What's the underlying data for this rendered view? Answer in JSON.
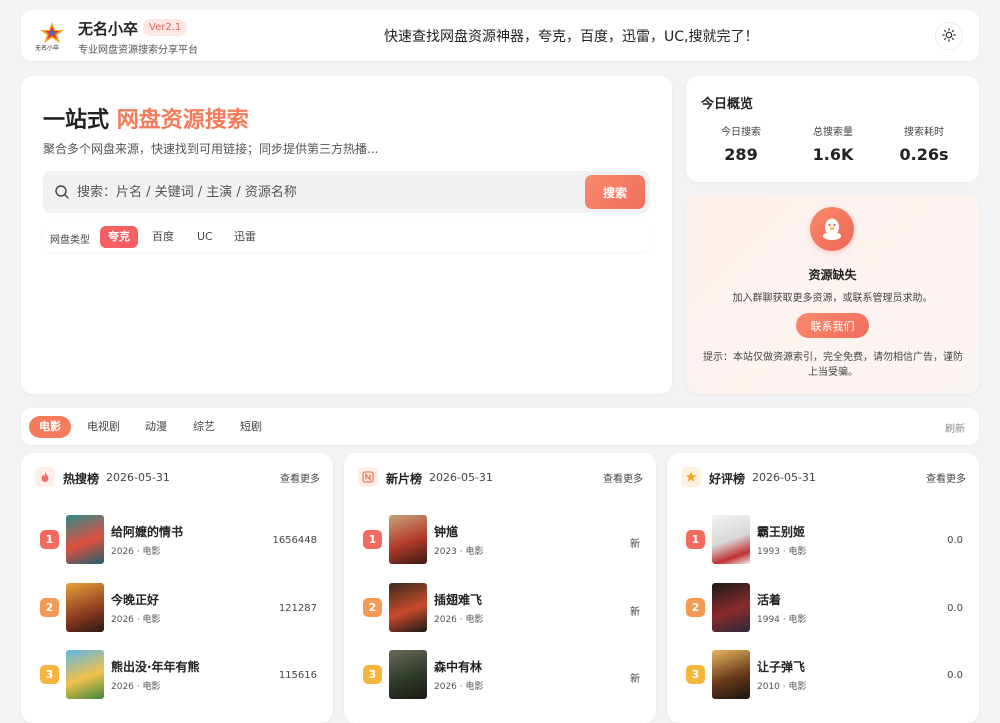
{
  "header": {
    "logo_text": "无名小卒",
    "brand_name": "无名小卒",
    "version": "Ver2.1",
    "subtitle": "专业网盘资源搜索分享平台",
    "slogan": "快速查找网盘资源神器，夸克，百度，迅雷，UC,搜就完了！",
    "theme_icon": "sun-icon"
  },
  "search": {
    "title_prefix": "一站式",
    "title_accent": "网盘资源搜索",
    "description": "聚合多个网盘来源，快速找到可用链接；同步提供第三方热播...",
    "placeholder": "搜索：片名 / 关键词 / 主演 / 资源名称",
    "button_label": "搜索",
    "type_label": "网盘类型",
    "types": [
      "夸克",
      "百度",
      "UC",
      "迅雷"
    ],
    "active_type": "夸克"
  },
  "overview": {
    "title": "今日概览",
    "stats": [
      {
        "label": "今日搜索",
        "value": "289"
      },
      {
        "label": "总搜索量",
        "value": "1.6K"
      },
      {
        "label": "搜索耗时",
        "value": "0.26s"
      }
    ]
  },
  "missing": {
    "icon": "qq-penguin-icon",
    "title": "资源缺失",
    "description": "加入群聊获取更多资源，或联系管理员求助。",
    "button_label": "联系我们",
    "tip": "提示：本站仅做资源索引，完全免费，请勿相信广告，谨防上当受骗。"
  },
  "categories": {
    "tabs": [
      "电影",
      "电视剧",
      "动漫",
      "综艺",
      "短剧"
    ],
    "active": "电影",
    "refresh_label": "刷新"
  },
  "rankings": [
    {
      "title": "热搜榜",
      "date": "2026-05-31",
      "more_label": "查看更多",
      "icon": "fire-icon",
      "icon_color": "#f06d5f",
      "items": [
        {
          "rank": "1",
          "name": "给阿嬷的情书",
          "year": "2026",
          "genre": "电影",
          "score": "1656448"
        },
        {
          "rank": "2",
          "name": "今晚正好",
          "year": "2026",
          "genre": "电影",
          "score": "121287"
        },
        {
          "rank": "3",
          "name": "熊出没·年年有熊",
          "year": "2026",
          "genre": "电影",
          "score": "115616"
        }
      ]
    },
    {
      "title": "新片榜",
      "date": "2026-05-31",
      "more_label": "查看更多",
      "icon": "new-badge-icon",
      "icon_color": "#f47b5b",
      "items": [
        {
          "rank": "1",
          "name": "钟馗",
          "year": "2023",
          "genre": "电影",
          "score": "新"
        },
        {
          "rank": "2",
          "name": "插翅难飞",
          "year": "2026",
          "genre": "电影",
          "score": "新"
        },
        {
          "rank": "3",
          "name": "森中有林",
          "year": "2026",
          "genre": "电影",
          "score": "新"
        }
      ]
    },
    {
      "title": "好评榜",
      "date": "2026-05-31",
      "more_label": "查看更多",
      "icon": "star-icon",
      "icon_color": "#f5a623",
      "items": [
        {
          "rank": "1",
          "name": "霸王别姬",
          "year": "1993",
          "genre": "电影",
          "score": "0.0"
        },
        {
          "rank": "2",
          "name": "活着",
          "year": "1994",
          "genre": "电影",
          "score": "0.0"
        },
        {
          "rank": "3",
          "name": "让子弹飞",
          "year": "2010",
          "genre": "电影",
          "score": "0.0"
        }
      ]
    }
  ],
  "colors": {
    "accent": "#f47b5b",
    "rank_1": "#f26b5e",
    "rank_2": "#f59a55",
    "rank_3": "#f6b53c"
  }
}
